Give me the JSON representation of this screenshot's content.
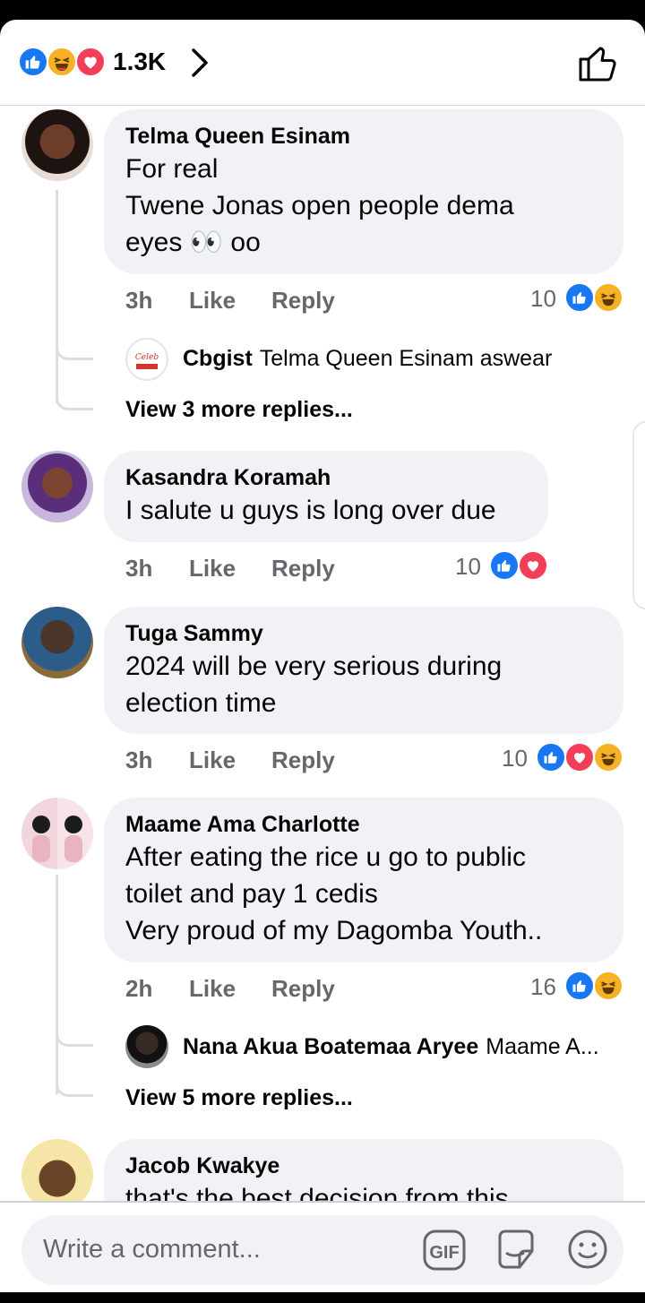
{
  "header": {
    "reactions": [
      "like",
      "haha",
      "love"
    ],
    "count": "1.3K",
    "colors": {
      "like": "#1877f2",
      "haha": "#f7b125",
      "love": "#f33e58"
    }
  },
  "comments": [
    {
      "name": "Telma Queen  Esinam",
      "text": "For real\nTwene Jonas open people dema\neyes 👀 oo",
      "time": "3h",
      "like_label": "Like",
      "reply_label": "Reply",
      "reaction_count": "10",
      "reactions": [
        "like",
        "haha"
      ],
      "reply": {
        "author": "Cbgist",
        "text": "Telma Queen  Esinam aswear"
      },
      "more_replies": "View 3 more replies..."
    },
    {
      "name": "Kasandra Koramah",
      "text": "I salute u guys is long over due",
      "time": "3h",
      "like_label": "Like",
      "reply_label": "Reply",
      "reaction_count": "10",
      "reactions": [
        "like",
        "love"
      ]
    },
    {
      "name": "Tuga Sammy",
      "text": "2024 will be very serious during\nelection time",
      "time": "3h",
      "like_label": "Like",
      "reply_label": "Reply",
      "reaction_count": "10",
      "reactions": [
        "like",
        "love",
        "haha"
      ]
    },
    {
      "name": "Maame Ama Charlotte",
      "text": "After eating the rice u go to public\ntoilet and pay 1 cedis\nVery proud of my Dagomba Youth..",
      "time": "2h",
      "like_label": "Like",
      "reply_label": "Reply",
      "reaction_count": "16",
      "reactions": [
        "like",
        "haha"
      ],
      "reply": {
        "author": "Nana Akua Boatemaa Aryee",
        "text": "Maame A..."
      },
      "more_replies": "View 5 more replies..."
    },
    {
      "name": "Jacob Kwakye",
      "text": "that's the best decision from this"
    }
  ],
  "composer": {
    "placeholder": "Write a comment...",
    "icons": [
      "gif-icon",
      "sticker-icon",
      "emoji-icon"
    ]
  }
}
